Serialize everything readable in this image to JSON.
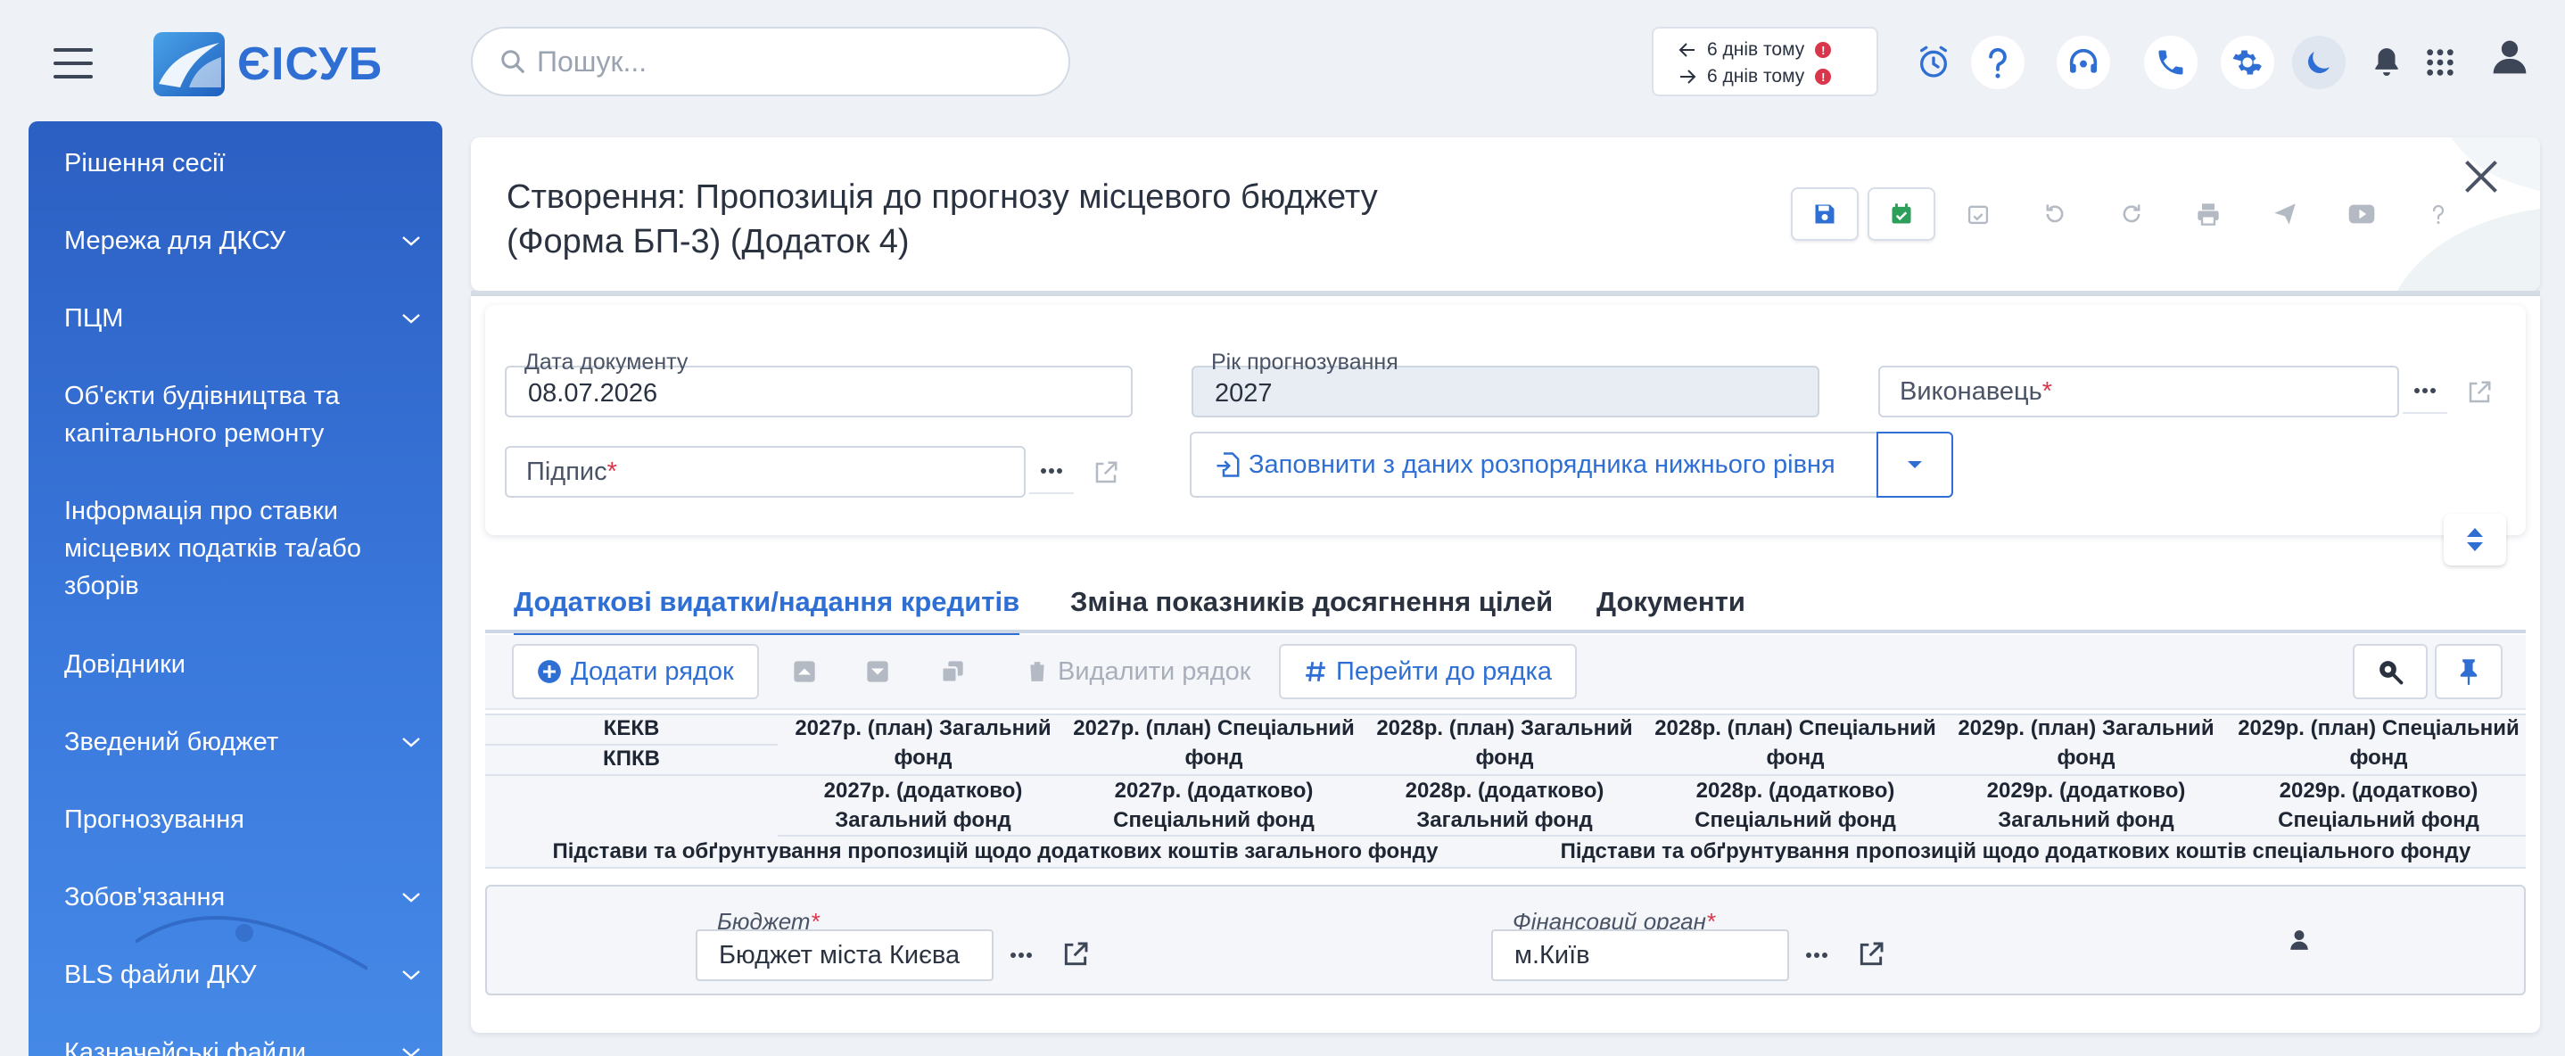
{
  "app": {
    "brand": "ЄІСУБ"
  },
  "search": {
    "placeholder": "Пошук..."
  },
  "history": {
    "back": "6 днів тому",
    "forward": "6 днів тому",
    "badge": "!"
  },
  "header_icons": [
    "alarm-clock-icon",
    "help-icon",
    "support-headset-icon",
    "phone-icon",
    "gear-icon",
    "moon-icon",
    "bell-icon",
    "apps-grid-icon",
    "user-icon"
  ],
  "sidebar": {
    "items": [
      {
        "label": "Рішення сесії",
        "expandable": false
      },
      {
        "label": "Мережа для ДКСУ",
        "expandable": true
      },
      {
        "label": "ПЦМ",
        "expandable": true
      },
      {
        "label": "Об'єкти будівництва та капітального ремонту",
        "expandable": false
      },
      {
        "label": "Інформація про ставки місцевих податків та/або зборів",
        "expandable": false
      },
      {
        "label": "Довідники",
        "expandable": false
      },
      {
        "label": "Зведений бюджет",
        "expandable": true
      },
      {
        "label": "Прогнозування",
        "expandable": false
      },
      {
        "label": "Зобов'язання",
        "expandable": true
      },
      {
        "label": "BLS файли ДКУ",
        "expandable": true
      },
      {
        "label": "Казначейські файли",
        "expandable": true
      }
    ]
  },
  "document": {
    "title": "Створення: Пропозиція до прогнозу місцевого бюджету (Форма БП-3) (Додаток 4)"
  },
  "form": {
    "date_label": "Дата документу",
    "date_value": "08.07.2026",
    "year_label": "Рік прогнозування",
    "year_value": "2027",
    "executor_label": "Виконавець",
    "signature_label": "Підпис",
    "required_mark": "*",
    "fill_button": "Заповнити з даних розпорядника нижнього рівня"
  },
  "tabs": [
    {
      "label": "Додаткові видатки/надання кредитів",
      "active": true
    },
    {
      "label": "Зміна показників досягнення цілей",
      "active": false
    },
    {
      "label": "Документи",
      "active": false
    }
  ],
  "grid_toolbar": {
    "add_row": "Додати рядок",
    "delete_row": "Видалити рядок",
    "goto_row": "Перейти до рядка"
  },
  "grid": {
    "kekv": "КЕКВ",
    "kpkv": "КПКВ",
    "plan_columns": [
      [
        "2027р. (план) Загальний",
        "фонд"
      ],
      [
        "2027р. (план) Спеціальний",
        "фонд"
      ],
      [
        "2028р. (план) Загальний",
        "фонд"
      ],
      [
        "2028р. (план) Спеціальний",
        "фонд"
      ],
      [
        "2029р. (план) Загальний",
        "фонд"
      ],
      [
        "2029р. (план) Спеціальний",
        "фонд"
      ]
    ],
    "extra_columns": [
      [
        "2027р. (додатково)",
        "Загальний фонд"
      ],
      [
        "2027р. (додатково)",
        "Спеціальний фонд"
      ],
      [
        "2028р. (додатково)",
        "Загальний фонд"
      ],
      [
        "2028р. (додатково)",
        "Спеціальний фонд"
      ],
      [
        "2029р. (додатково)",
        "Загальний фонд"
      ],
      [
        "2029р. (додатково)",
        "Спеціальний фонд"
      ]
    ],
    "basis_general": "Підстави та обґрунтування пропозицій щодо додаткових коштів загального фонду",
    "basis_special": "Підстави та обґрунтування пропозицій щодо додаткових коштів спеціального фонду"
  },
  "row": {
    "budget_label": "Бюджет",
    "budget_value": "Бюджет міста Києва",
    "fin_label": "Фінансовий орган",
    "fin_value": "м.Київ"
  },
  "colors": {
    "accent": "#2f6fd4",
    "sidebar": "#3a78dc",
    "required": "#d9364b",
    "save_green": "#2e9e5b"
  }
}
